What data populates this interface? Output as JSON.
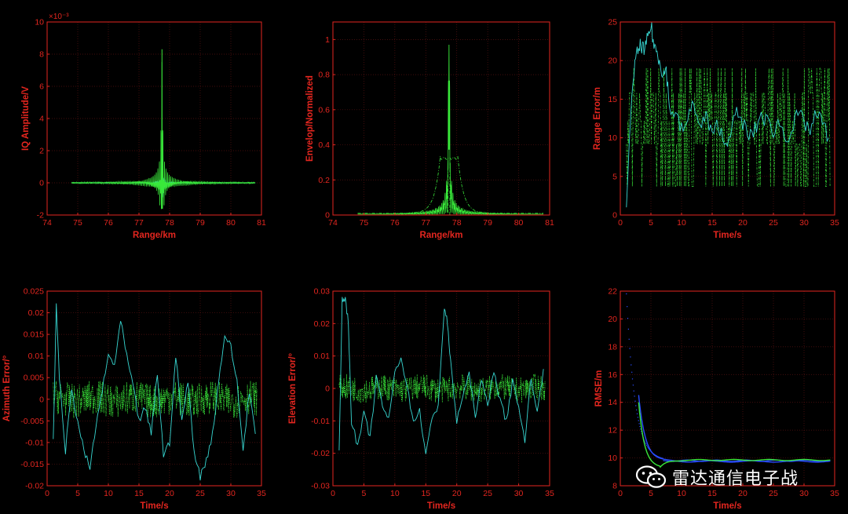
{
  "colors": {
    "axis": "#e3261f",
    "grid": "#5a1212",
    "green": "#39e83a",
    "cyan": "#37d7d2",
    "blue": "#2a4cff",
    "background": "#000000"
  },
  "watermark": {
    "text": "雷达通信电子战",
    "icon": "wechat-icon"
  },
  "chart_data": [
    {
      "id": "iq",
      "type": "line",
      "xlabel": "Range/km",
      "ylabel": "IQ Amplitude/V",
      "exponent": "×10⁻³",
      "xlim": [
        74,
        81
      ],
      "ylim": [
        -2,
        10
      ],
      "xticks": [
        74,
        75,
        76,
        77,
        78,
        79,
        80,
        81
      ],
      "yticks": [
        -2,
        0,
        2,
        4,
        6,
        8,
        10
      ],
      "grid": true,
      "peak": {
        "x": 77.75,
        "y": 8.3
      },
      "series": [
        {
          "color": "green",
          "kind": "sinc-I",
          "x_range": [
            74.8,
            80.8
          ],
          "peak": 8.3,
          "min": -1.6
        },
        {
          "color": "cyan",
          "kind": "sinc-Q",
          "x_range": [
            74.8,
            80.8
          ],
          "peak": 2.0,
          "min": -1.0
        }
      ]
    },
    {
      "id": "env",
      "type": "line",
      "xlabel": "Range/km",
      "ylabel": "Envelop/Normalized",
      "xlim": [
        74,
        81
      ],
      "ylim": [
        0,
        1.1
      ],
      "xticks": [
        74,
        75,
        76,
        77,
        78,
        79,
        80,
        81
      ],
      "yticks": [
        0,
        0.2,
        0.4,
        0.6,
        0.8,
        1
      ],
      "grid": true,
      "series": [
        {
          "color": "green",
          "kind": "normalized envelope",
          "x_range": [
            74.8,
            80.8
          ],
          "peak": 1.0,
          "peak_x": 77.75
        },
        {
          "color": "green",
          "kind": "wide lobe (dash-dot)",
          "x_range": [
            74.8,
            80.8
          ],
          "plateau": 0.33
        }
      ]
    },
    {
      "id": "range",
      "type": "line",
      "xlabel": "Time/s",
      "ylabel": "Range Error/m",
      "xlim": [
        0,
        35
      ],
      "ylim": [
        0,
        25
      ],
      "xticks": [
        0,
        5,
        10,
        15,
        20,
        25,
        30,
        35
      ],
      "yticks": [
        0,
        5,
        10,
        15,
        20,
        25
      ],
      "grid": true,
      "series": [
        {
          "color": "green",
          "kind": "measurement (dash-dot)",
          "levels": [
            3.7,
            9.2,
            12.2,
            15.8,
            19.0
          ]
        },
        {
          "color": "cyan",
          "kind": "filtered",
          "x": [
            1,
            1.5,
            2,
            2.5,
            3,
            3.5,
            4,
            4.5,
            5,
            5.5,
            6,
            6.5,
            7,
            7.5,
            8,
            9,
            10,
            11,
            12,
            13,
            14,
            15,
            16,
            17,
            18,
            19,
            20,
            21,
            22,
            23,
            24,
            25,
            26,
            27,
            28,
            29,
            30,
            31,
            32,
            33,
            34
          ],
          "y": [
            1,
            10,
            17,
            20,
            21.5,
            22,
            21,
            23,
            24.5,
            22,
            21,
            20,
            18,
            19,
            14,
            13,
            11,
            12,
            15,
            11,
            13,
            10,
            12,
            9,
            11,
            13,
            12,
            10,
            11,
            13,
            12,
            11,
            12,
            10,
            11,
            13,
            12,
            11,
            13,
            12,
            10
          ]
        }
      ]
    },
    {
      "id": "az",
      "type": "line",
      "xlabel": "Time/s",
      "ylabel": "Azimuth Error/°",
      "xlim": [
        0,
        35
      ],
      "ylim": [
        -0.02,
        0.025
      ],
      "xticks": [
        0,
        5,
        10,
        15,
        20,
        25,
        30,
        35
      ],
      "yticks": [
        -0.02,
        -0.015,
        -0.01,
        -0.005,
        0,
        0.005,
        0.01,
        0.015,
        0.02,
        0.025
      ],
      "grid": true,
      "series": [
        {
          "color": "green",
          "kind": "measurement (dash-dot)",
          "amplitude": 0.004
        },
        {
          "color": "cyan",
          "kind": "filtered",
          "x": [
            1,
            1.5,
            2,
            3,
            4,
            5,
            6,
            7,
            8,
            9,
            10,
            11,
            12,
            13,
            14,
            15,
            16,
            17,
            18,
            19,
            20,
            21,
            22,
            23,
            24,
            25,
            26,
            27,
            28,
            29,
            30,
            31,
            32,
            33,
            34
          ],
          "y": [
            -0.01,
            0.022,
            0.005,
            -0.012,
            0.002,
            -0.005,
            -0.012,
            -0.016,
            -0.006,
            0.002,
            0.01,
            0.008,
            0.018,
            0.01,
            0.003,
            -0.005,
            -0.002,
            -0.008,
            0.006,
            -0.013,
            -0.01,
            0.01,
            -0.005,
            0.004,
            -0.012,
            -0.018,
            -0.014,
            -0.008,
            0.004,
            0.015,
            0.012,
            0.004,
            -0.012,
            0.002,
            -0.008
          ]
        }
      ]
    },
    {
      "id": "el",
      "type": "line",
      "xlabel": "Time/s",
      "ylabel": "Elevation Error/°",
      "xlim": [
        0,
        35
      ],
      "ylim": [
        -0.03,
        0.03
      ],
      "xticks": [
        0,
        5,
        10,
        15,
        20,
        25,
        30,
        35
      ],
      "yticks": [
        -0.03,
        -0.02,
        -0.01,
        0,
        0.01,
        0.02,
        0.03
      ],
      "grid": true,
      "series": [
        {
          "color": "green",
          "kind": "measurement (dash-dot)",
          "amplitude": 0.004
        },
        {
          "color": "cyan",
          "kind": "filtered",
          "x": [
            1,
            1.5,
            2,
            2.5,
            3,
            4,
            5,
            6,
            7,
            8,
            9,
            10,
            11,
            12,
            13,
            14,
            15,
            16,
            17,
            18,
            18.5,
            19,
            20,
            21,
            22,
            23,
            24,
            25,
            26,
            27,
            28,
            29,
            30,
            31,
            32,
            33,
            34
          ],
          "y": [
            -0.02,
            0.027,
            0.028,
            0.02,
            -0.01,
            -0.018,
            -0.008,
            -0.015,
            0.003,
            -0.005,
            -0.01,
            0.005,
            0.01,
            0.0,
            -0.01,
            -0.007,
            -0.02,
            -0.01,
            -0.005,
            0.025,
            0.02,
            0.008,
            -0.01,
            -0.002,
            0.004,
            -0.008,
            0.002,
            -0.005,
            0.006,
            -0.004,
            -0.01,
            0.002,
            -0.005,
            -0.017,
            0.004,
            -0.008,
            0.006
          ]
        }
      ]
    },
    {
      "id": "rmse",
      "type": "line",
      "xlabel": "Time/s",
      "ylabel": "RMSE/m",
      "xlim": [
        0,
        35
      ],
      "ylim": [
        8,
        22
      ],
      "xticks": [
        0,
        5,
        10,
        15,
        20,
        25,
        30,
        35
      ],
      "yticks": [
        8,
        10,
        12,
        14,
        16,
        18,
        20,
        22
      ],
      "grid": true,
      "series": [
        {
          "color": "blue",
          "kind": "dotted decay",
          "start": [
            1,
            21.8
          ],
          "floor": 9.8
        },
        {
          "color": "green",
          "kind": "decay with dip",
          "start": [
            3,
            14
          ],
          "min": [
            6.5,
            9.3
          ],
          "floor": 9.85
        },
        {
          "color": "blue",
          "kind": "solid decay",
          "start": [
            3,
            14.5
          ],
          "floor": 9.75
        }
      ]
    }
  ]
}
